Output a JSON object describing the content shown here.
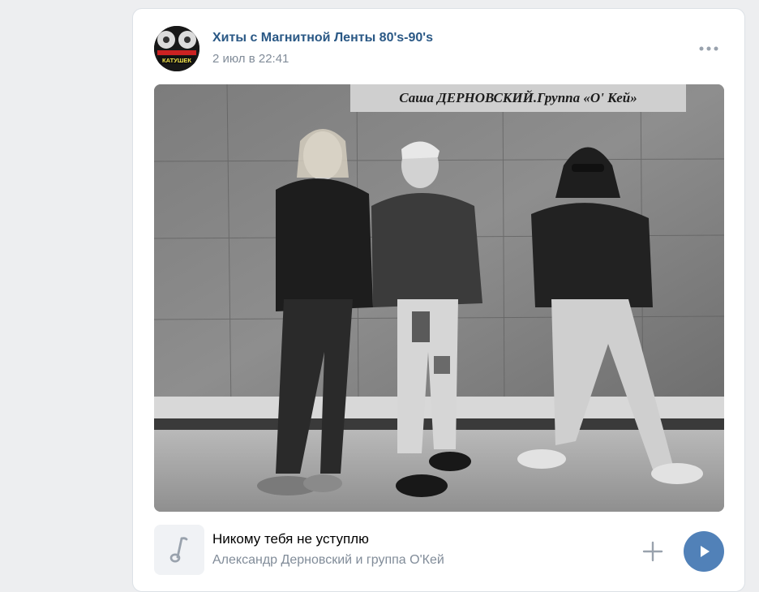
{
  "post": {
    "group_name": "Хиты с Магнитной Ленты 80's-90's",
    "date": "2 июл в 22:41",
    "avatar_caption": "КАТУШЕК",
    "photo_caption": "Саша ДЕРНОВСКИЙ.Группа «О' Кей»"
  },
  "audio": {
    "title": "Никому тебя не уступлю",
    "artist": "Александр Дерновский и группа О'Кей"
  },
  "colors": {
    "link": "#2a5885",
    "secondary_text": "#818c99",
    "accent": "#5181b8",
    "card_bg": "#ffffff",
    "page_bg": "#edeef0"
  },
  "icons": {
    "more": "more-horizontal-icon",
    "note": "music-note-icon",
    "add": "plus-icon",
    "play": "play-icon"
  }
}
